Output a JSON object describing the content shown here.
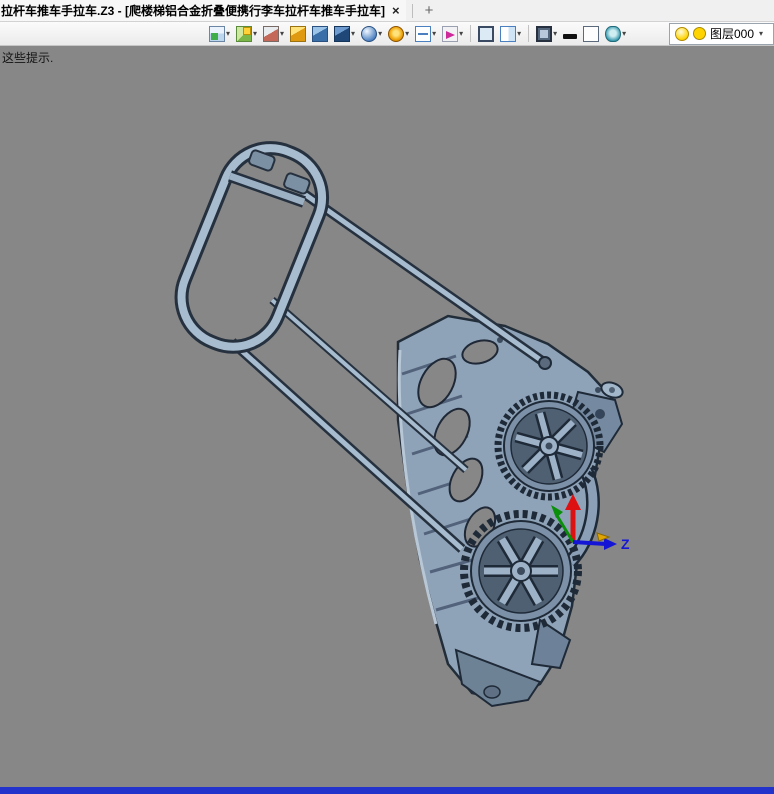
{
  "window": {
    "tab_title": "拉杆车推车手拉车.Z3 - [爬楼梯铝合金折叠便携行李车拉杆车推车手拉车]",
    "tab_close": "×",
    "new_tab_label": "+"
  },
  "toolbar": {
    "dropdown_glyph": "▾",
    "icons": [
      {
        "name": "screen-capture-icon",
        "shape": "capture",
        "dropdown": true
      },
      {
        "name": "appearance-icon",
        "shape": "paint",
        "dropdown": true
      },
      {
        "name": "wireframe-display-icon",
        "shape": "cube-red",
        "dropdown": true
      },
      {
        "name": "shaded-display-icon",
        "shape": "cube-yellow",
        "dropdown": false
      },
      {
        "name": "solid-display-icon",
        "shape": "cube-blue",
        "dropdown": false
      },
      {
        "name": "shaded-edges-display-icon",
        "shape": "cube-blue-dark",
        "dropdown": true
      },
      {
        "name": "render-material-icon",
        "shape": "sphere",
        "dropdown": true
      },
      {
        "name": "spin-view-icon",
        "shape": "wheel",
        "dropdown": true
      },
      {
        "name": "section-view-icon",
        "shape": "section",
        "dropdown": true
      },
      {
        "name": "view-orientation-icon",
        "shape": "compass",
        "dropdown": true
      },
      {
        "sep": true
      },
      {
        "name": "fullscreen-icon",
        "shape": "monitor",
        "dropdown": false
      },
      {
        "name": "viewport-split-icon",
        "shape": "viewport",
        "dropdown": true
      },
      {
        "sep": true
      },
      {
        "name": "display-settings-icon",
        "shape": "monitor-dark",
        "dropdown": true
      },
      {
        "name": "edge-width-icon",
        "shape": "line-black",
        "dropdown": false
      },
      {
        "name": "background-color-icon",
        "shape": "rect-plain",
        "dropdown": false
      },
      {
        "name": "visibility-filter-icon",
        "shape": "eye",
        "dropdown": true
      }
    ],
    "layer": {
      "label": "图层000"
    }
  },
  "canvas": {
    "hint_text": "这些提示.",
    "axis": {
      "z_label": "Z"
    }
  },
  "colors": {
    "canvas_bg": "#878787",
    "status_bar": "#2233cc",
    "model_body": "#8fa3b8",
    "model_outline": "#222d3a",
    "tab_bg": "#f0f0f0",
    "axis_x_red": "#dd1111",
    "axis_y_green": "#0a8f0a",
    "axis_z_blue": "#1515d5",
    "layer_swatch_yellow": "#ffd400"
  }
}
